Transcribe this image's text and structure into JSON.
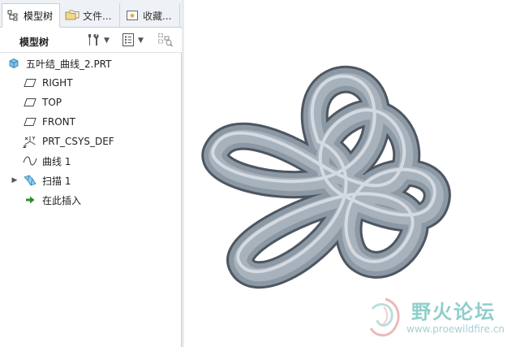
{
  "tabs": [
    {
      "label": "模型树",
      "icon": "model-tree-icon"
    },
    {
      "label": "文件...",
      "icon": "folder-browser-icon"
    },
    {
      "label": "收藏...",
      "icon": "favorites-icon"
    }
  ],
  "toolbar": {
    "title": "模型树",
    "settings_icon": "tree-settings-icon",
    "show_icon": "tree-show-icon",
    "filter_icon": "tree-filter-icon"
  },
  "tree": {
    "root": {
      "label": "五叶结_曲线_2.PRT",
      "icon": "part-icon"
    },
    "items": [
      {
        "label": "RIGHT",
        "icon": "datum-plane-icon",
        "expandable": false
      },
      {
        "label": "TOP",
        "icon": "datum-plane-icon",
        "expandable": false
      },
      {
        "label": "FRONT",
        "icon": "datum-plane-icon",
        "expandable": false
      },
      {
        "label": "PRT_CSYS_DEF",
        "icon": "coordinate-system-icon",
        "expandable": false
      },
      {
        "label": "曲线 1",
        "icon": "curve-icon",
        "expandable": false
      },
      {
        "label": "扫描 1",
        "icon": "sweep-icon",
        "expandable": true
      },
      {
        "label": "在此插入",
        "icon": "insert-here-arrow-icon",
        "expandable": false
      }
    ]
  },
  "watermark": {
    "title": "野火论坛",
    "url": "www.proewildfire.cn"
  },
  "colors": {
    "tube": "#8e9aa6",
    "tube_highlight": "#dfe4ea",
    "tube_shadow": "#5b6571",
    "accent": "#3b8fd9"
  }
}
